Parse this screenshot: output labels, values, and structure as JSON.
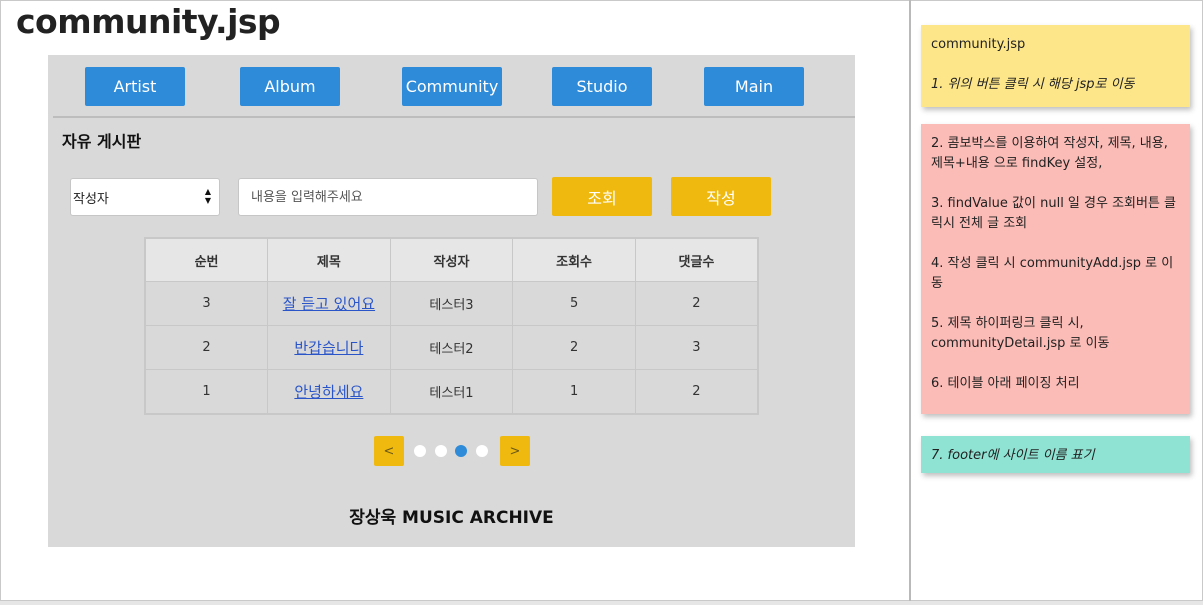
{
  "page_title": "community.jsp",
  "nav": {
    "buttons": [
      "Artist",
      "Album",
      "Community",
      "Studio",
      "Main"
    ],
    "color": "#2e8bd9"
  },
  "board": {
    "title": "자유 게시판",
    "select_value": "작성자",
    "search_placeholder": "내용을 입력해주세요",
    "search_button": "조회",
    "write_button": "작성",
    "accent_color": "#f0b90f",
    "columns": [
      "순번",
      "제목",
      "작성자",
      "조회수",
      "댓글수"
    ],
    "rows": [
      {
        "no": "3",
        "title": "잘 듣고 있어요",
        "author": "테스터3",
        "views": "5",
        "comments": "2"
      },
      {
        "no": "2",
        "title": "반갑습니다",
        "author": "테스터2",
        "views": "2",
        "comments": "3"
      },
      {
        "no": "1",
        "title": "안녕하세요",
        "author": "테스터1",
        "views": "1",
        "comments": "2"
      }
    ]
  },
  "pagination": {
    "prev": "<",
    "next": ">",
    "pages": 4,
    "current": 3
  },
  "footer": "장상욱 MUSIC ARCHIVE",
  "notes": {
    "yellow": {
      "line1": "community.jsp",
      "line2": "1. 위의 버튼 클릭 시 해당 jsp로 이동"
    },
    "pink": {
      "line1": "2. 콤보박스를 이용하여 작성자, 제목, 내용, 제목+내용 으로 findKey 설정,",
      "line2": "3. findValue 값이 null 일 경우 조회버튼 클릭시 전체 글 조회",
      "line3": "4. 작성 클릭 시 communityAdd.jsp 로 이동",
      "line4": "5. 제목 하이퍼링크 클릭 시, communityDetail.jsp 로 이동",
      "line5": "6. 테이블 아래 페이징 처리"
    },
    "teal": {
      "line1": "7. footer에 사이트 이름 표기"
    }
  }
}
